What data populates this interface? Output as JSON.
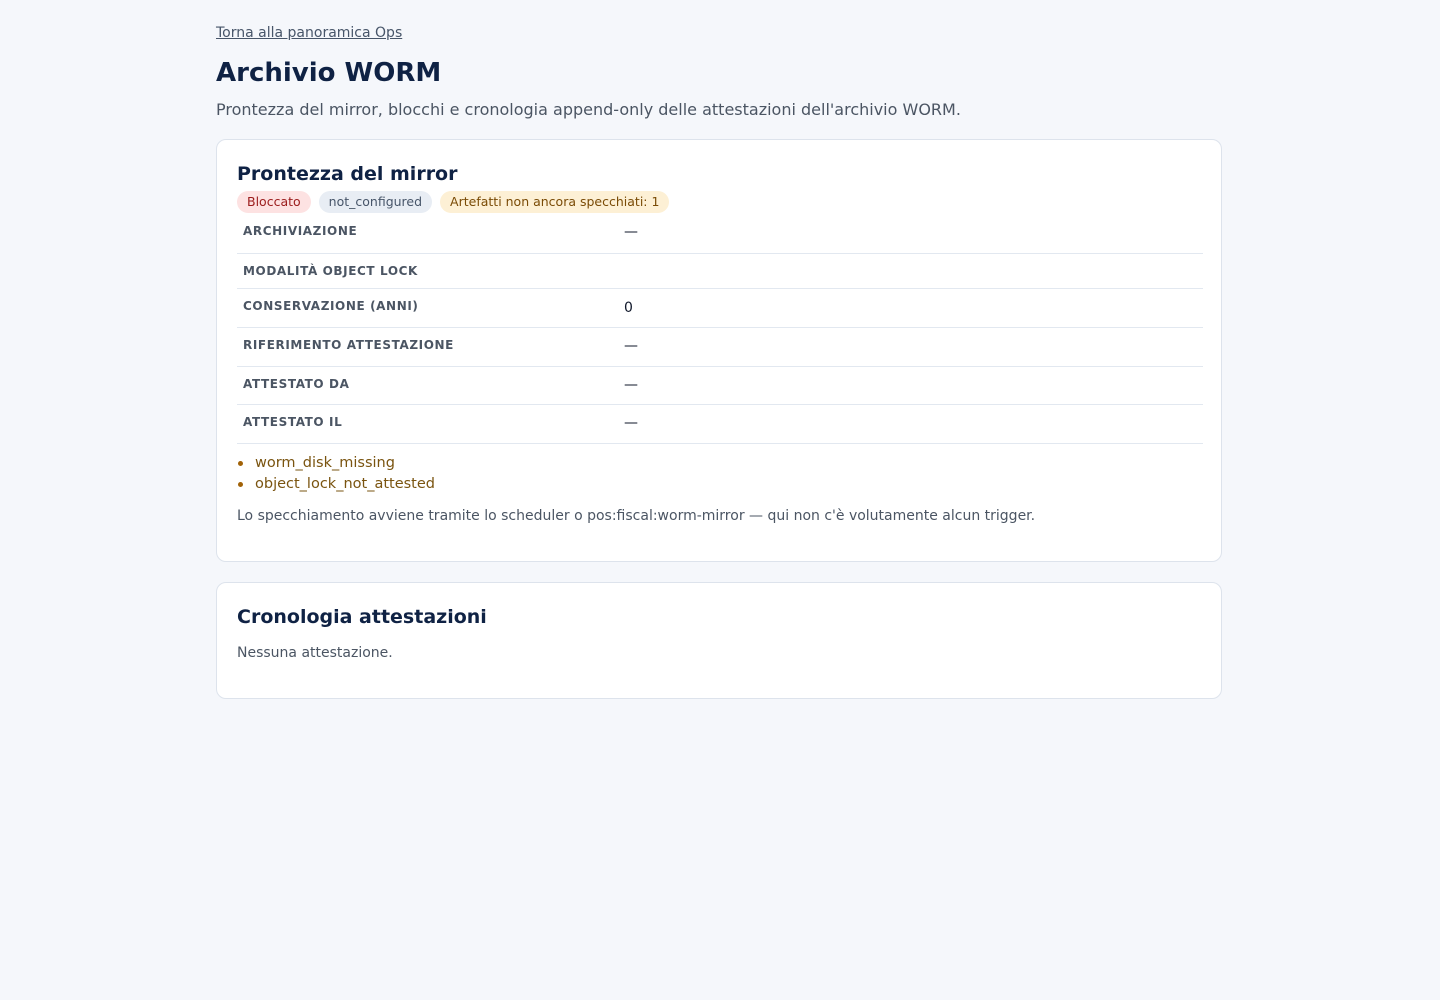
{
  "nav": {
    "back_link": "Torna alla panoramica Ops"
  },
  "header": {
    "title": "Archivio WORM",
    "subtitle": "Prontezza del mirror, blocchi e cronologia append-only delle attestazioni dell'archivio WORM."
  },
  "mirror": {
    "title": "Prontezza del mirror",
    "badges": [
      {
        "label": "Bloccato",
        "tone": "#9b1c1c"
      },
      {
        "label": "not_configured",
        "tone": "#475569"
      },
      {
        "label": "Artefatti non ancora specchiati: 1",
        "tone": "#7a4b06"
      }
    ],
    "rows": [
      {
        "label": "Archiviazione",
        "value": "—"
      },
      {
        "label": "Modalità Object Lock",
        "value": ""
      },
      {
        "label": "Conservazione (anni)",
        "value": "0"
      },
      {
        "label": "Riferimento attestazione",
        "value": "—"
      },
      {
        "label": "Attestato da",
        "value": "—"
      },
      {
        "label": "Attestato il",
        "value": "—"
      }
    ],
    "warnings": [
      "worm_disk_missing",
      "object_lock_not_attested"
    ],
    "note": "Lo specchiamento avviene tramite lo scheduler o pos:fiscal:worm-mirror — qui non c'è volutamente alcun trigger."
  },
  "history": {
    "title": "Cronologia attestazioni",
    "empty_text": "Nessuna attestazione."
  },
  "colors": {
    "page_background": "#f5f7fb",
    "title": "#0f2244",
    "blocked_badge_bg": "#fde2e2",
    "status_badge_bg": "#e8edf4",
    "pending_badge_bg": "#fdf0d5",
    "warning_text": "#7a5410"
  }
}
